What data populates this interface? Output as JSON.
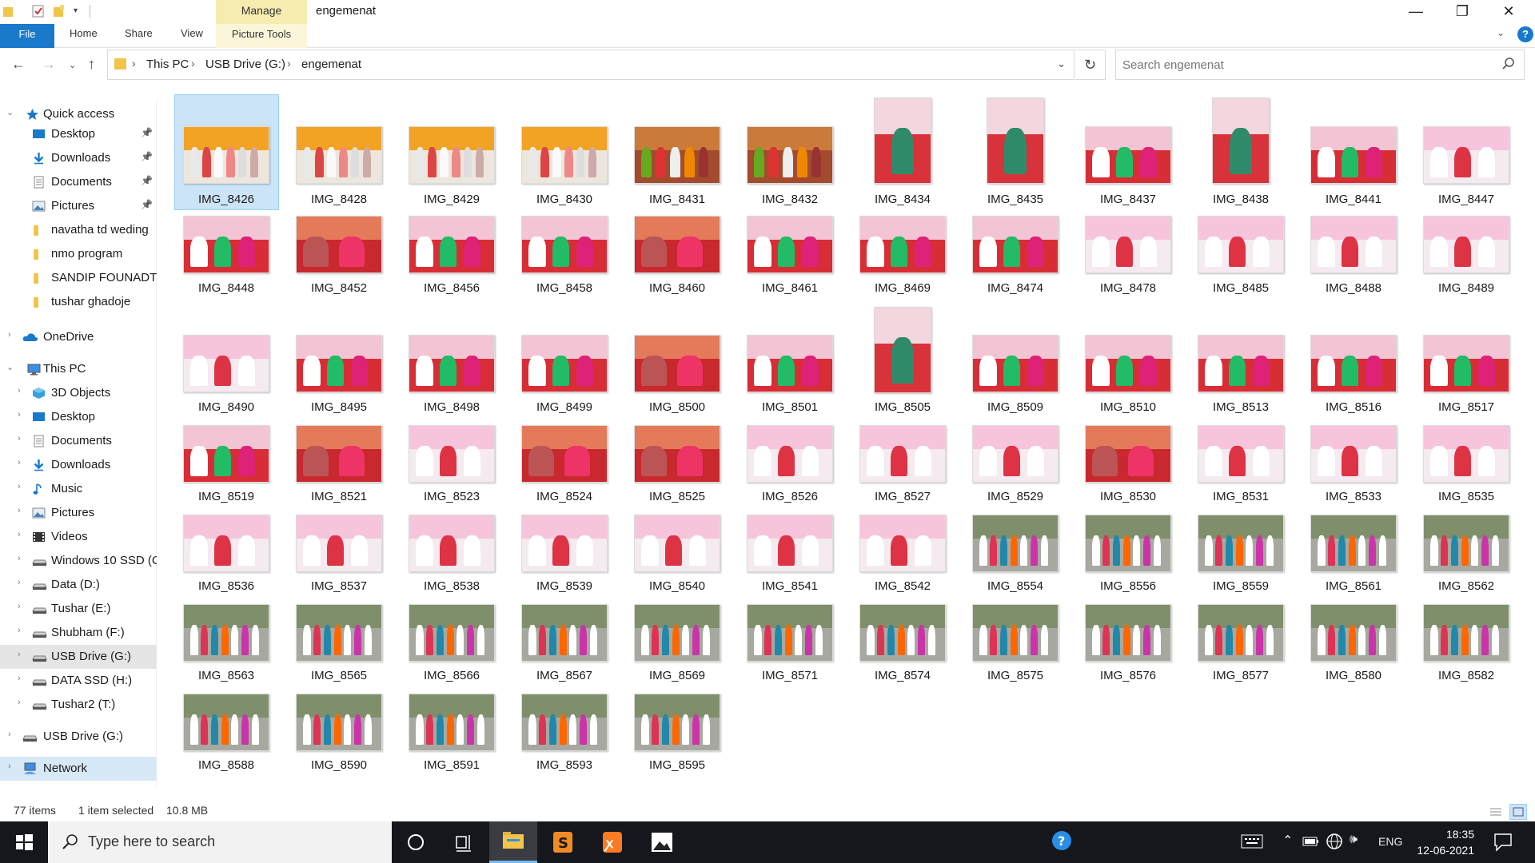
{
  "window": {
    "title": "engemenat",
    "manage_tab": "Manage",
    "picture_tools_tab": "Picture Tools",
    "minimize": "—",
    "maximize": "❐",
    "close": "✕"
  },
  "ribbon": {
    "file": "File",
    "tabs": [
      "Home",
      "Share",
      "View"
    ],
    "help": "?"
  },
  "address": {
    "crumbs": [
      "This PC",
      "USB Drive (G:)",
      "engemenat"
    ],
    "search_placeholder": "Search engemenat"
  },
  "nav": {
    "quick_access": "Quick access",
    "quick_items": [
      {
        "label": "Desktop",
        "icon": "desktop-icon",
        "pinned": true
      },
      {
        "label": "Downloads",
        "icon": "download-icon",
        "pinned": true
      },
      {
        "label": "Documents",
        "icon": "documents-icon",
        "pinned": true
      },
      {
        "label": "Pictures",
        "icon": "pictures-icon",
        "pinned": true
      },
      {
        "label": "navatha td weding",
        "icon": "folder-icon",
        "pinned": false
      },
      {
        "label": "nmo program",
        "icon": "folder-icon",
        "pinned": false
      },
      {
        "label": "SANDIP FOUNADTI",
        "icon": "folder-icon",
        "pinned": false
      },
      {
        "label": "tushar ghadoje",
        "icon": "folder-icon",
        "pinned": false
      }
    ],
    "onedrive": "OneDrive",
    "this_pc": "This PC",
    "pc_items": [
      {
        "label": "3D Objects",
        "icon": "3d-objects-icon"
      },
      {
        "label": "Desktop",
        "icon": "desktop-icon"
      },
      {
        "label": "Documents",
        "icon": "documents-icon"
      },
      {
        "label": "Downloads",
        "icon": "download-icon"
      },
      {
        "label": "Music",
        "icon": "music-icon"
      },
      {
        "label": "Pictures",
        "icon": "pictures-icon"
      },
      {
        "label": "Videos",
        "icon": "videos-icon"
      },
      {
        "label": "Windows 10 SSD (C",
        "icon": "drive-icon"
      },
      {
        "label": "Data (D:)",
        "icon": "drive-icon"
      },
      {
        "label": "Tushar (E:)",
        "icon": "drive-icon"
      },
      {
        "label": "Shubham (F:)",
        "icon": "drive-icon"
      },
      {
        "label": "USB Drive (G:)",
        "icon": "drive-icon"
      },
      {
        "label": "DATA SSD (H:)",
        "icon": "drive-icon"
      },
      {
        "label": "Tushar2 (T:)",
        "icon": "drive-icon"
      }
    ],
    "usb_drive": "USB Drive (G:)",
    "network": "Network"
  },
  "files": [
    {
      "name": "IMG_8426",
      "kind": "crowd",
      "selected": true
    },
    {
      "name": "IMG_8428",
      "kind": "crowd"
    },
    {
      "name": "IMG_8429",
      "kind": "crowd"
    },
    {
      "name": "IMG_8430",
      "kind": "crowd"
    },
    {
      "name": "IMG_8431",
      "kind": "crowd2"
    },
    {
      "name": "IMG_8432",
      "kind": "crowd2"
    },
    {
      "name": "IMG_8434",
      "kind": "portrait"
    },
    {
      "name": "IMG_8435",
      "kind": "portrait"
    },
    {
      "name": "IMG_8437",
      "kind": "ceremony"
    },
    {
      "name": "IMG_8438",
      "kind": "portrait"
    },
    {
      "name": "IMG_8441",
      "kind": "ceremony"
    },
    {
      "name": "IMG_8447",
      "kind": "pink"
    },
    {
      "name": "IMG_8448",
      "kind": "ceremony"
    },
    {
      "name": "IMG_8452",
      "kind": "close"
    },
    {
      "name": "IMG_8456",
      "kind": "ceremony"
    },
    {
      "name": "IMG_8458",
      "kind": "ceremony"
    },
    {
      "name": "IMG_8460",
      "kind": "close"
    },
    {
      "name": "IMG_8461",
      "kind": "ceremony"
    },
    {
      "name": "IMG_8469",
      "kind": "ceremony"
    },
    {
      "name": "IMG_8474",
      "kind": "ceremony"
    },
    {
      "name": "IMG_8478",
      "kind": "pink"
    },
    {
      "name": "IMG_8485",
      "kind": "pink"
    },
    {
      "name": "IMG_8488",
      "kind": "pink"
    },
    {
      "name": "IMG_8489",
      "kind": "pink"
    },
    {
      "name": "IMG_8490",
      "kind": "pink"
    },
    {
      "name": "IMG_8495",
      "kind": "ceremony"
    },
    {
      "name": "IMG_8498",
      "kind": "ceremony"
    },
    {
      "name": "IMG_8499",
      "kind": "ceremony"
    },
    {
      "name": "IMG_8500",
      "kind": "close"
    },
    {
      "name": "IMG_8501",
      "kind": "ceremony"
    },
    {
      "name": "IMG_8505",
      "kind": "portrait"
    },
    {
      "name": "IMG_8509",
      "kind": "ceremony"
    },
    {
      "name": "IMG_8510",
      "kind": "ceremony"
    },
    {
      "name": "IMG_8513",
      "kind": "ceremony"
    },
    {
      "name": "IMG_8516",
      "kind": "ceremony"
    },
    {
      "name": "IMG_8517",
      "kind": "ceremony"
    },
    {
      "name": "IMG_8519",
      "kind": "ceremony"
    },
    {
      "name": "IMG_8521",
      "kind": "close"
    },
    {
      "name": "IMG_8523",
      "kind": "pink"
    },
    {
      "name": "IMG_8524",
      "kind": "close"
    },
    {
      "name": "IMG_8525",
      "kind": "close"
    },
    {
      "name": "IMG_8526",
      "kind": "pink"
    },
    {
      "name": "IMG_8527",
      "kind": "pink"
    },
    {
      "name": "IMG_8529",
      "kind": "pink"
    },
    {
      "name": "IMG_8530",
      "kind": "close"
    },
    {
      "name": "IMG_8531",
      "kind": "pink"
    },
    {
      "name": "IMG_8533",
      "kind": "pink"
    },
    {
      "name": "IMG_8535",
      "kind": "pink"
    },
    {
      "name": "IMG_8536",
      "kind": "pink"
    },
    {
      "name": "IMG_8537",
      "kind": "pink"
    },
    {
      "name": "IMG_8538",
      "kind": "pink"
    },
    {
      "name": "IMG_8539",
      "kind": "pink"
    },
    {
      "name": "IMG_8540",
      "kind": "pink"
    },
    {
      "name": "IMG_8541",
      "kind": "pink"
    },
    {
      "name": "IMG_8542",
      "kind": "pink"
    },
    {
      "name": "IMG_8554",
      "kind": "group"
    },
    {
      "name": "IMG_8556",
      "kind": "group"
    },
    {
      "name": "IMG_8559",
      "kind": "group"
    },
    {
      "name": "IMG_8561",
      "kind": "group"
    },
    {
      "name": "IMG_8562",
      "kind": "group"
    },
    {
      "name": "IMG_8563",
      "kind": "group"
    },
    {
      "name": "IMG_8565",
      "kind": "group"
    },
    {
      "name": "IMG_8566",
      "kind": "group"
    },
    {
      "name": "IMG_8567",
      "kind": "group"
    },
    {
      "name": "IMG_8569",
      "kind": "group"
    },
    {
      "name": "IMG_8571",
      "kind": "group"
    },
    {
      "name": "IMG_8574",
      "kind": "group"
    },
    {
      "name": "IMG_8575",
      "kind": "group"
    },
    {
      "name": "IMG_8576",
      "kind": "group"
    },
    {
      "name": "IMG_8577",
      "kind": "group"
    },
    {
      "name": "IMG_8580",
      "kind": "group"
    },
    {
      "name": "IMG_8582",
      "kind": "group"
    },
    {
      "name": "IMG_8588",
      "kind": "group"
    },
    {
      "name": "IMG_8590",
      "kind": "group"
    },
    {
      "name": "IMG_8591",
      "kind": "group"
    },
    {
      "name": "IMG_8593",
      "kind": "group"
    },
    {
      "name": "IMG_8595",
      "kind": "group"
    }
  ],
  "status": {
    "items": "77 items",
    "selected": "1 item selected",
    "size": "10.8 MB"
  },
  "taskbar": {
    "search_placeholder": "Type here to search",
    "lang": "ENG",
    "time": "18:35",
    "date": "12-06-2021"
  },
  "colors": {
    "accent": "#1979ca",
    "selection": "#cce4f7",
    "manage": "#f7ecb0",
    "folder": "#f1c54b"
  }
}
